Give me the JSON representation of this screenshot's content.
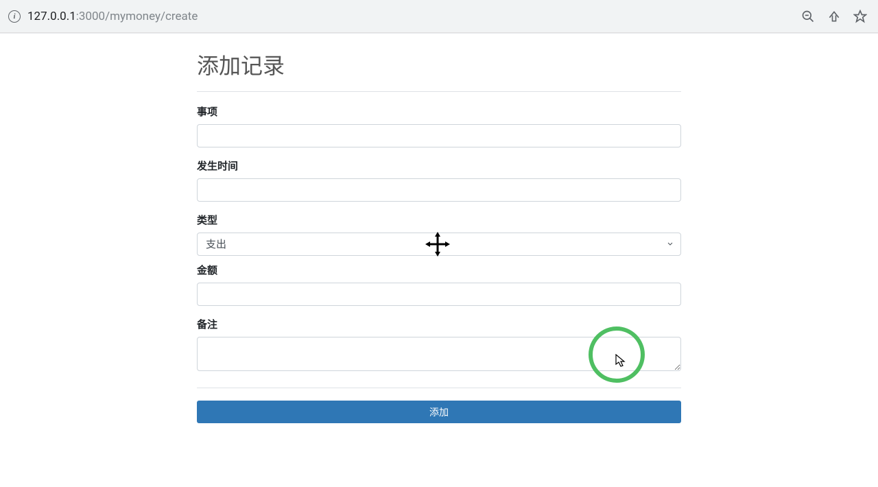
{
  "browser": {
    "url_host": "127.0.0.1",
    "url_port_path": ":3000/mymoney/create"
  },
  "page": {
    "title": "添加记录"
  },
  "form": {
    "item": {
      "label": "事项",
      "value": ""
    },
    "time": {
      "label": "发生时间",
      "value": ""
    },
    "type": {
      "label": "类型",
      "selected": "支出"
    },
    "amount": {
      "label": "金额",
      "value": ""
    },
    "note": {
      "label": "备注",
      "value": ""
    },
    "submit": "添加"
  }
}
